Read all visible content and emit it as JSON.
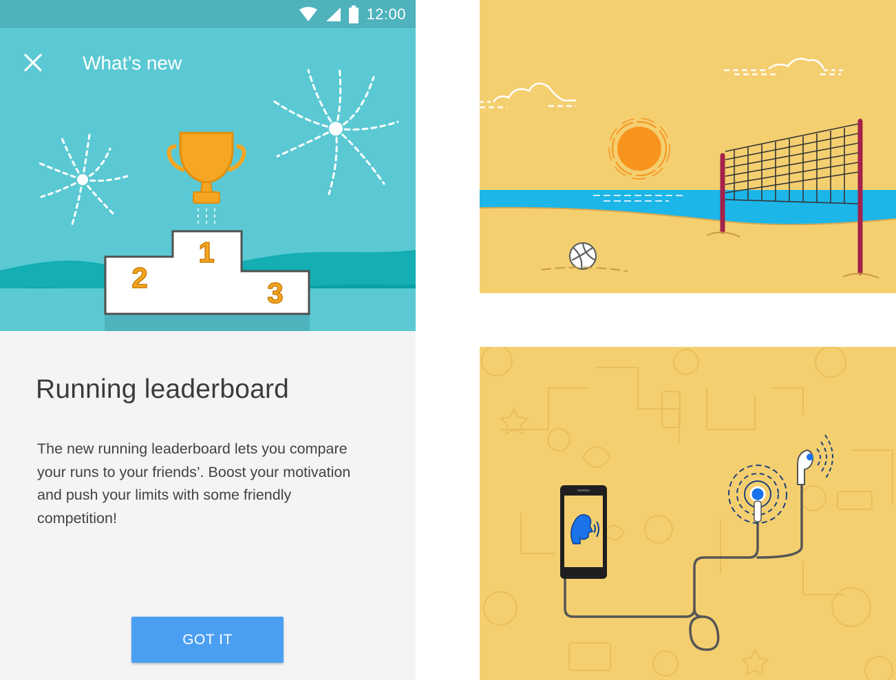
{
  "status_bar": {
    "time": "12:00",
    "icons": [
      "wifi-icon",
      "cell-signal-icon",
      "battery-icon"
    ]
  },
  "toolbar": {
    "close_icon": "close-icon",
    "title": "What’s new"
  },
  "hero": {
    "podium_places": [
      "1",
      "2",
      "3"
    ],
    "trophy_icon": "trophy-icon"
  },
  "card": {
    "title": "Running leaderboard",
    "body": "The new running leaderboard lets you compare your runs to your friends’. Boost your motivation and push your limits with some friendly competition!",
    "button_label": "GOT IT"
  },
  "colors": {
    "status_bar": "#4eb3bd",
    "hero_bg": "#5bc9d4",
    "wave": "#0aa6ad",
    "accent_button": "#4a9ff3",
    "trophy": "#f5a623",
    "illustration_bg": "#f4cf70",
    "sea": "#1cb6e8",
    "sun": "#f7941d"
  }
}
